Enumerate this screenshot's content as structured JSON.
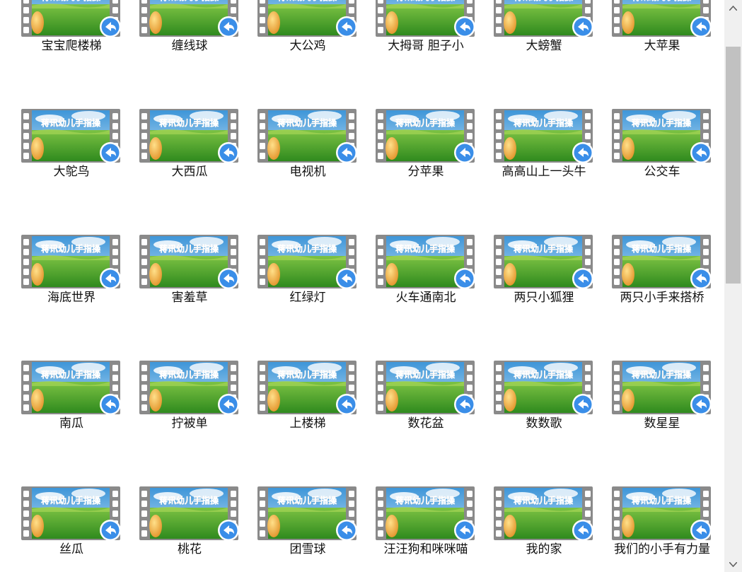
{
  "thumbnail_caption": "蒋讯幼儿手指操",
  "items": [
    {
      "label": "宝宝爬楼梯"
    },
    {
      "label": "缠线球"
    },
    {
      "label": "大公鸡"
    },
    {
      "label": "大拇哥 胆子小"
    },
    {
      "label": "大螃蟹"
    },
    {
      "label": "大苹果"
    },
    {
      "label": "大鸵鸟"
    },
    {
      "label": "大西瓜"
    },
    {
      "label": "电视机"
    },
    {
      "label": "分苹果"
    },
    {
      "label": "高高山上一头牛"
    },
    {
      "label": "公交车"
    },
    {
      "label": "海底世界"
    },
    {
      "label": "害羞草"
    },
    {
      "label": "红绿灯"
    },
    {
      "label": "火车通南北"
    },
    {
      "label": "两只小狐狸"
    },
    {
      "label": "两只小手来搭桥"
    },
    {
      "label": "南瓜"
    },
    {
      "label": "拧被单"
    },
    {
      "label": "上楼梯"
    },
    {
      "label": "数花盆"
    },
    {
      "label": "数数歌"
    },
    {
      "label": "数星星"
    },
    {
      "label": "丝瓜"
    },
    {
      "label": "桃花"
    },
    {
      "label": "团雪球"
    },
    {
      "label": "汪汪狗和咪咪喵"
    },
    {
      "label": "我的家"
    },
    {
      "label": "我们的小手有力量"
    }
  ],
  "colors": {
    "sky_top": "#3e95d8",
    "sky_bottom": "#bfe2f5",
    "grass_top": "#7cc243",
    "grass_bottom": "#2f8a1e",
    "film": "#8a8a8a",
    "caption": "#e86a1b",
    "badge": "#3a8ee8"
  },
  "icons": {
    "badge": "share-arrow-icon",
    "frame": "film-strip-icon"
  }
}
